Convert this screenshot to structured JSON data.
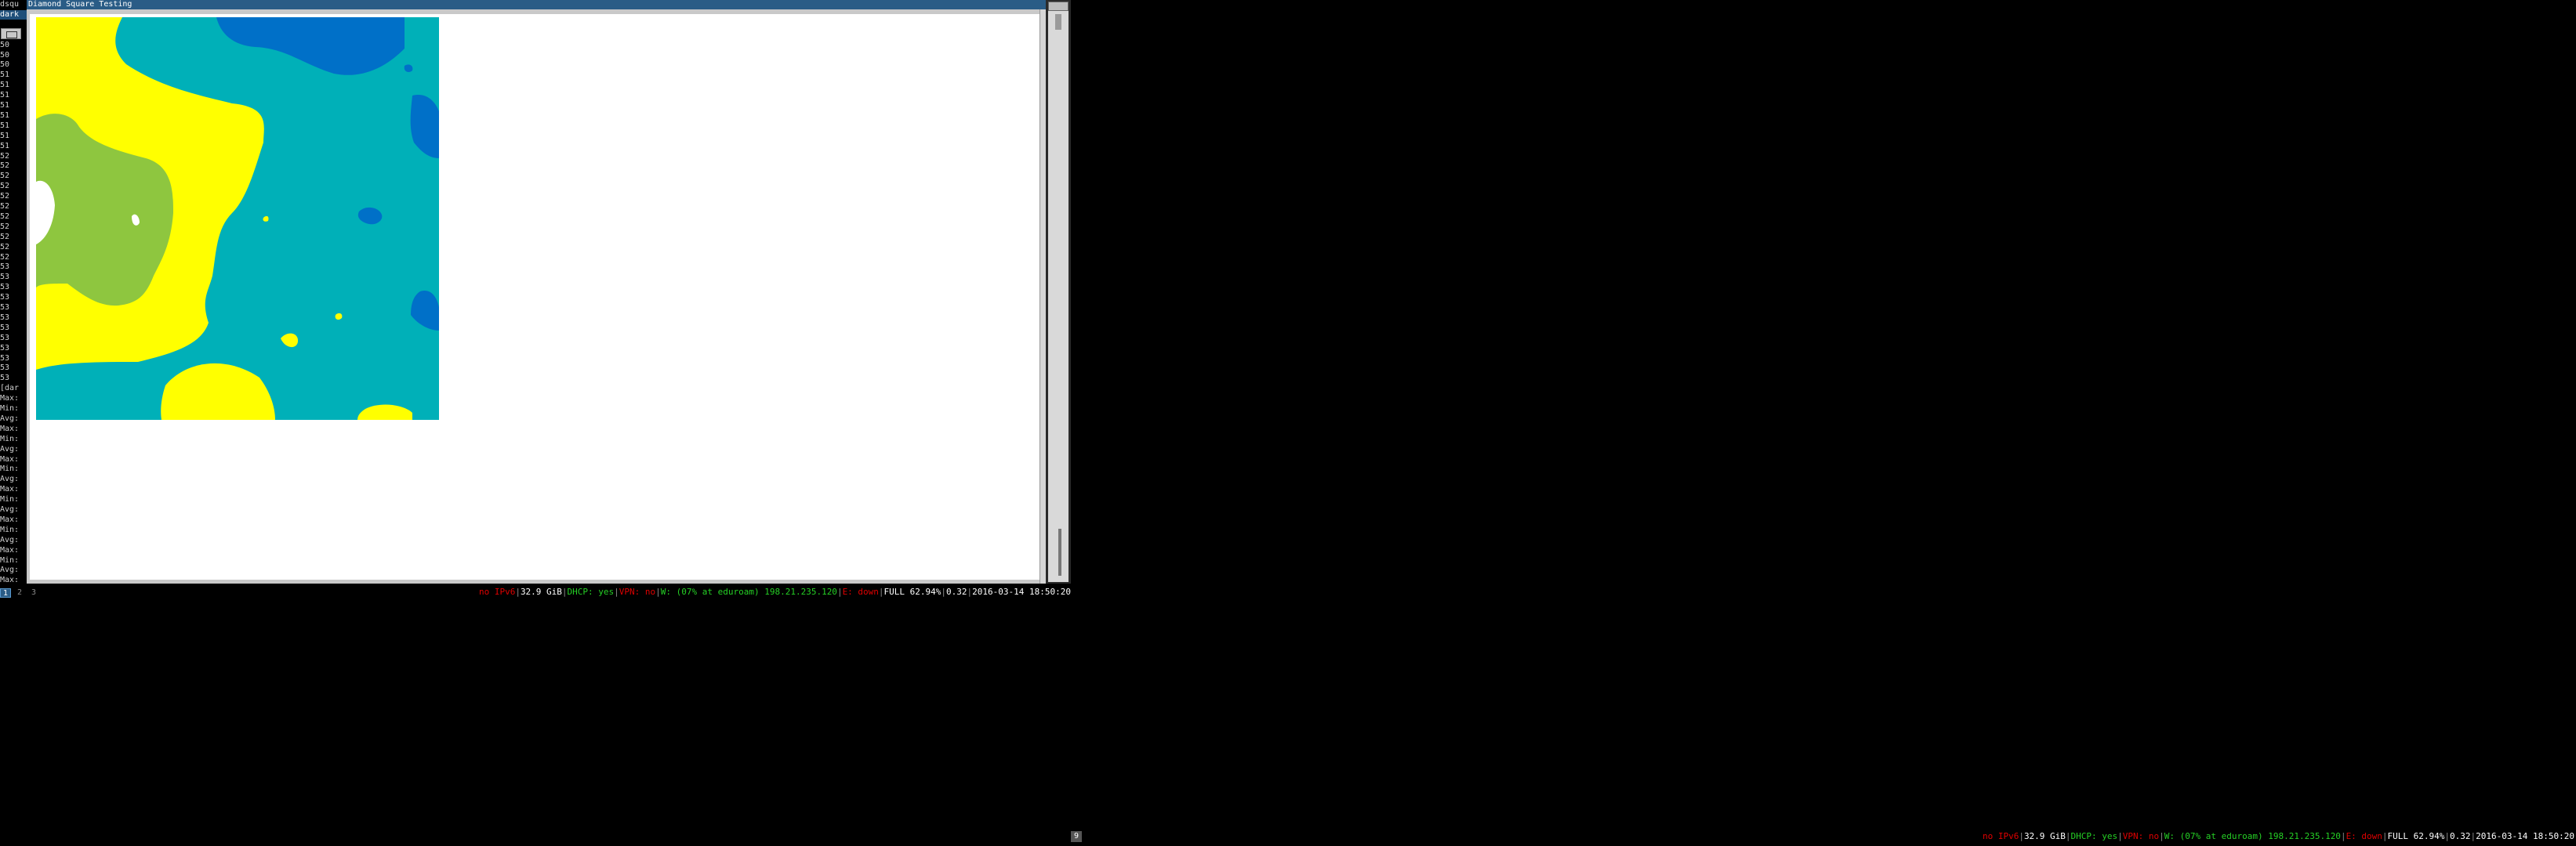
{
  "window": {
    "title": "Diamond Square Testing"
  },
  "terminal": {
    "lines": [
      "dsqu",
      "dark",
      "",
      "",
      "50",
      "50",
      "50",
      "51",
      "51",
      "51",
      "51",
      "51",
      "51",
      "51",
      "51",
      "52",
      "52",
      "52",
      "52",
      "52",
      "52",
      "52",
      "52",
      "52",
      "52",
      "52",
      "53",
      "53",
      "53",
      "53",
      "53",
      "53",
      "53",
      "53",
      "53",
      "53",
      "53",
      "53",
      "[dar",
      "Max:",
      "Min:",
      "Avg:",
      "Max:",
      "Min:",
      "Avg:",
      "Max:",
      "Min:",
      "Avg:",
      "Max:",
      "Min:",
      "Avg:",
      "Max:",
      "Min:",
      "Avg:",
      "Max:",
      "Min:",
      "Avg:",
      "Max:",
      "Min:",
      "Avg:",
      ""
    ]
  },
  "workspaces": [
    "1",
    "2",
    "3"
  ],
  "status": {
    "ipv6": "no IPv6",
    "disk": "32.9 GiB",
    "dhcp": "DHCP: yes",
    "vpn": "VPN: no",
    "wifi": "W: (07% at eduroam) 198.21.235.120",
    "eth": "E: down",
    "battery": "FULL 62.94%",
    "load": "0.32",
    "datetime": "2016-03-14 18:50:20"
  },
  "tray": {
    "label": "9"
  },
  "colors": {
    "titlebar": "#2a5c86",
    "yellow": "#ffff00",
    "teal": "#00b0b8",
    "blue": "#0070c8",
    "green": "#8ec63f",
    "white": "#ffffff",
    "red": "#e00000",
    "status_green": "#25d025"
  }
}
